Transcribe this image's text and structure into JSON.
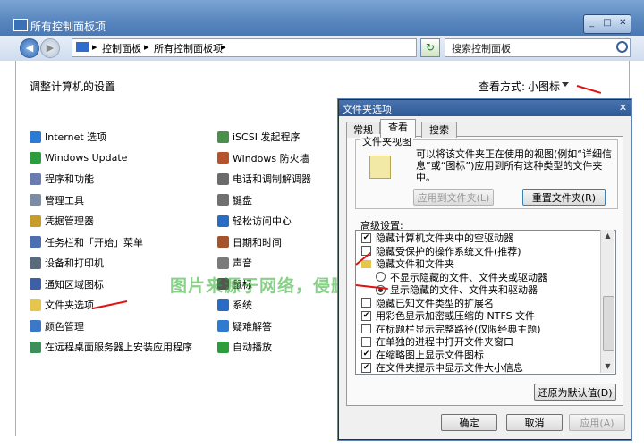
{
  "window": {
    "title": "所有控制面板项"
  },
  "title_buttons": [
    "_",
    "□",
    "✕"
  ],
  "nav": {
    "back_glyph": "◀",
    "forward_glyph": "▶",
    "breadcrumbs": [
      "控制面板",
      "所有控制面板项"
    ],
    "crumb_separator": "▸",
    "refresh_glyph": "↻",
    "search_text": "搜索控制面板"
  },
  "main": {
    "title": "调整计算机的设置",
    "view_label": "查看方式:",
    "view_value": "小图标"
  },
  "items_left": [
    {
      "label": "Internet 选项",
      "color": "#2a7bd6"
    },
    {
      "label": "Windows Update",
      "color": "#2d9c3c"
    },
    {
      "label": "程序和功能",
      "color": "#6a7bb0"
    },
    {
      "label": "管理工具",
      "color": "#7b8ca6"
    },
    {
      "label": "凭据管理器",
      "color": "#c79c2a"
    },
    {
      "label": "任务栏和「开始」菜单",
      "color": "#4b6fb0"
    },
    {
      "label": "设备和打印机",
      "color": "#5a6a7a"
    },
    {
      "label": "通知区域图标",
      "color": "#3c5fa5"
    },
    {
      "label": "文件夹选项",
      "color": "#e6c64a"
    },
    {
      "label": "颜色管理",
      "color": "#3b78c8"
    },
    {
      "label": "在远程桌面服务器上安装应用程序",
      "color": "#3d8f5a"
    }
  ],
  "items_right": [
    {
      "label": "iSCSI 发起程序",
      "color": "#4a8f4a"
    },
    {
      "label": "Windows 防火墙",
      "color": "#b5532c"
    },
    {
      "label": "电话和调制解调器",
      "color": "#6b6b6b"
    },
    {
      "label": "键盘",
      "color": "#707070"
    },
    {
      "label": "轻松访问中心",
      "color": "#2a6bc4"
    },
    {
      "label": "日期和时间",
      "color": "#a5532c"
    },
    {
      "label": "声音",
      "color": "#7a7a7a"
    },
    {
      "label": "鼠标",
      "color": "#555"
    },
    {
      "label": "系统",
      "color": "#2a6bc4"
    },
    {
      "label": "疑难解答",
      "color": "#2f7bd0"
    },
    {
      "label": "自动播放",
      "color": "#2f9c3c"
    }
  ],
  "watermark": "图片来源于网络，侵删",
  "dialog": {
    "title": "文件夹选项",
    "close": "✕",
    "tabs": [
      "常规",
      "查看",
      "搜索"
    ],
    "folder_view_legend": "文件夹视图",
    "folder_view_desc": "可以将该文件夹正在使用的视图(例如“详细信息”或“图标”)应用到所有这种类型的文件夹中。",
    "apply_to_folders": "应用到文件夹(L)",
    "reset_folders": "重置文件夹(R)",
    "advanced_label": "高级设置:",
    "advanced": [
      {
        "type": "check",
        "checked": true,
        "label": "隐藏计算机文件夹中的空驱动器"
      },
      {
        "type": "check",
        "checked": false,
        "label": "隐藏受保护的操作系统文件(推荐)"
      },
      {
        "type": "folder",
        "label": "隐藏文件和文件夹"
      },
      {
        "type": "radio",
        "checked": false,
        "label": "不显示隐藏的文件、文件夹或驱动器"
      },
      {
        "type": "radio",
        "checked": true,
        "label": "显示隐藏的文件、文件夹和驱动器"
      },
      {
        "type": "check",
        "checked": false,
        "label": "隐藏已知文件类型的扩展名"
      },
      {
        "type": "check",
        "checked": true,
        "label": "用彩色显示加密或压缩的 NTFS 文件"
      },
      {
        "type": "check",
        "checked": false,
        "label": "在标题栏显示完整路径(仅限经典主题)"
      },
      {
        "type": "check",
        "checked": false,
        "label": "在单独的进程中打开文件夹窗口"
      },
      {
        "type": "check",
        "checked": true,
        "label": "在缩略图上显示文件图标"
      },
      {
        "type": "check",
        "checked": true,
        "label": "在文件夹提示中显示文件大小信息"
      }
    ],
    "restore_defaults": "还原为默认值(D)",
    "ok": "确定",
    "cancel": "取消",
    "apply": "应用(A)"
  },
  "scroll": {
    "up": "▲",
    "down": "▼"
  },
  "accent_color": "#e11111"
}
